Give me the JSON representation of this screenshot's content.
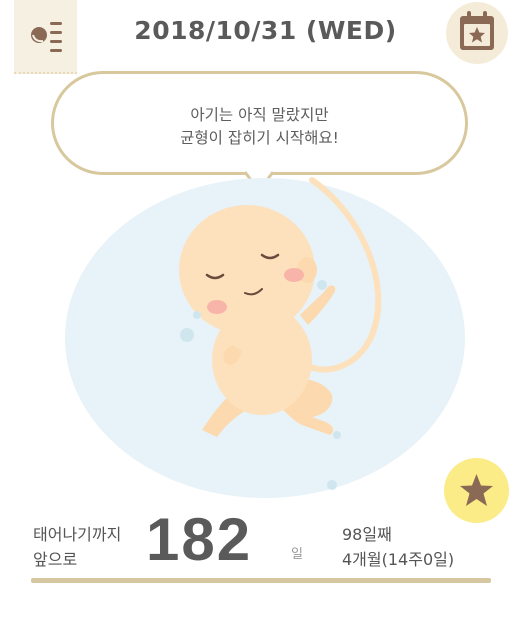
{
  "header": {
    "date": "2018/10/31 (WED)",
    "menu_icon": "menu-list-icon",
    "calendar_icon": "calendar-star-icon"
  },
  "bubble": {
    "line1": "아기는 아직 말랐지만",
    "line2": "균형이 잡히기 시작해요!"
  },
  "stats": {
    "until_label_line1": "태어나기까지",
    "until_label_line2": "앞으로",
    "days_left": "182",
    "days_unit": "일",
    "day_number": "98일째",
    "months_weeks": "4개월(14주0일)"
  },
  "colors": {
    "accent_gold": "#d8c89d",
    "bubble_bg": "#ffffff",
    "womb_blue": "#e7f3f8",
    "baby_skin": "#fde1bd",
    "star_button": "#fbec88",
    "text_dark": "#5a5a5a"
  },
  "fab": {
    "icon": "star-icon"
  }
}
